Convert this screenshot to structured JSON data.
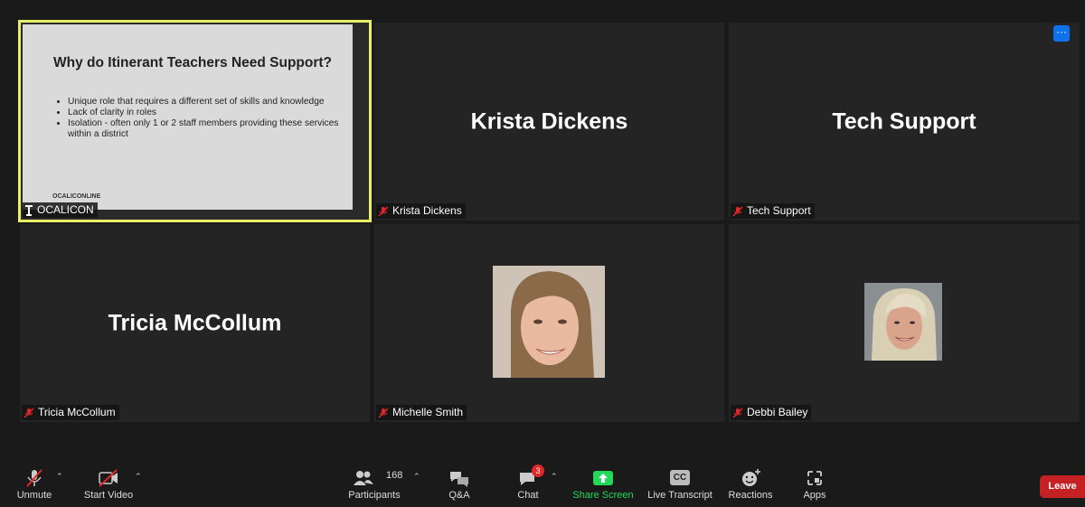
{
  "tiles": [
    {
      "id": "ocalicon",
      "name": "OCALICON",
      "type": "screen-share"
    },
    {
      "id": "krista",
      "name": "Krista Dickens",
      "display_name": "Krista Dickens"
    },
    {
      "id": "tech",
      "name": "Tech Support",
      "display_name": "Tech Support"
    },
    {
      "id": "tricia",
      "name": "Tricia McCollum",
      "display_name": "Tricia McCollum"
    },
    {
      "id": "michelle",
      "name": "Michelle Smith",
      "type": "photo"
    },
    {
      "id": "debbi",
      "name": "Debbi Bailey",
      "type": "photo"
    }
  ],
  "slide": {
    "title": "Why do Itinerant Teachers Need Support?",
    "bullets": [
      "Unique role that requires a different set of skills and knowledge",
      "Lack of clarity in roles",
      "Isolation - often only 1 or 2 staff members providing these services within a district"
    ],
    "logo": "OCALICONLINE"
  },
  "toolbar": {
    "unmute": "Unmute",
    "start_video": "Start Video",
    "participants": "Participants",
    "participants_count": "168",
    "qa": "Q&A",
    "chat": "Chat",
    "chat_badge": "3",
    "share_screen": "Share Screen",
    "live_transcript": "Live Transcript",
    "live_transcript_icon_text": "CC",
    "reactions": "Reactions",
    "apps": "Apps",
    "leave": "Leave"
  },
  "more_button": "···",
  "icons": {
    "mic_muted": "mic-muted-icon",
    "video_off": "video-off-icon",
    "participants": "participants-icon",
    "qa": "qa-icon",
    "chat": "chat-icon",
    "share": "share-screen-icon",
    "reactions": "reactions-icon",
    "apps": "apps-icon"
  },
  "colors": {
    "active_border": "#e8f06a",
    "share_green": "#23d959",
    "leave_red": "#c42124",
    "muted_red": "#e02828",
    "more_blue": "#0e72ed"
  }
}
